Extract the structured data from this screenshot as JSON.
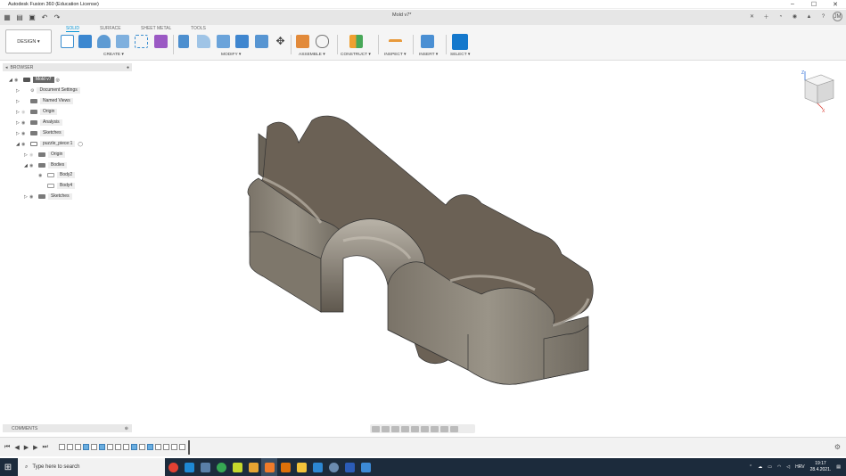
{
  "window": {
    "title": "Autodesk Fusion 360 (Education License)",
    "min": "–",
    "max": "☐",
    "close": "✕"
  },
  "qab": {
    "doc_tab": "Mold v7*",
    "tab_close": "✕",
    "avatar": "JM"
  },
  "toolbar": {
    "workspace": "DESIGN ▾",
    "tabs": [
      "SOLID",
      "SURFACE",
      "SHEET METAL",
      "TOOLS"
    ],
    "groups": [
      "CREATE ▾",
      "MODIFY ▾",
      "ASSEMBLE ▾",
      "CONSTRUCT ▾",
      "INSPECT ▾",
      "INSERT ▾",
      "SELECT ▾"
    ]
  },
  "browser": {
    "title": "BROWSER",
    "items": [
      {
        "label": "Mold v7"
      },
      {
        "label": "Document Settings"
      },
      {
        "label": "Named Views"
      },
      {
        "label": "Origin"
      },
      {
        "label": "Analysis"
      },
      {
        "label": "Sketches"
      },
      {
        "label": "puzzle_piece:1"
      },
      {
        "label": "Origin"
      },
      {
        "label": "Bodies"
      },
      {
        "label": "Body2"
      },
      {
        "label": "Body4"
      },
      {
        "label": "Sketches"
      }
    ]
  },
  "viewcube": {
    "z": "Z",
    "x": "X"
  },
  "comments": {
    "title": "COMMENTS"
  },
  "taskbar": {
    "search_placeholder": "Type here to search",
    "lang": "HRV",
    "time": "19:17",
    "date": "28.4.2021."
  },
  "colors": {
    "accent": "#0696d7",
    "model_top": "#6b6155",
    "model_side": "#8a8377",
    "taskbar": "#1c2b3c"
  }
}
